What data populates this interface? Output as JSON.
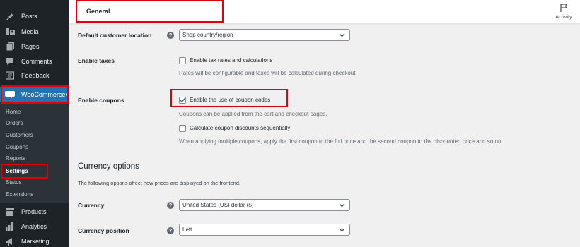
{
  "sidebar": {
    "top_items": [
      {
        "label": "Posts",
        "icon": "pin-icon"
      },
      {
        "label": "Media",
        "icon": "media-icon"
      },
      {
        "label": "Pages",
        "icon": "pages-icon"
      },
      {
        "label": "Comments",
        "icon": "comments-icon"
      },
      {
        "label": "Feedback",
        "icon": "feedback-icon"
      }
    ],
    "woocommerce": {
      "label": "WooCommerce",
      "icon": "woocommerce-icon"
    },
    "submenu": [
      "Home",
      "Orders",
      "Customers",
      "Coupons",
      "Reports",
      "Settings",
      "Status",
      "Extensions"
    ],
    "current_submenu": "Settings",
    "bottom_items": [
      {
        "label": "Products",
        "icon": "products-icon"
      },
      {
        "label": "Analytics",
        "icon": "analytics-icon"
      },
      {
        "label": "Marketing",
        "icon": "marketing-icon"
      }
    ]
  },
  "header": {
    "title": "General",
    "activity_label": "Activity"
  },
  "settings": {
    "default_location": {
      "label": "Default customer location",
      "value": "Shop country/region"
    },
    "enable_taxes": {
      "label": "Enable taxes",
      "checkbox_label": "Enable tax rates and calculations",
      "checked": false,
      "description": "Rates will be configurable and taxes will be calculated during checkout."
    },
    "enable_coupons": {
      "label": "Enable coupons",
      "checkbox_label": "Enable the use of coupon codes",
      "checked": true,
      "description": "Coupons can be applied from the cart and checkout pages.",
      "sequential_label": "Calculate coupon discounts sequentially",
      "sequential_checked": false,
      "sequential_description": "When applying multiple coupons, apply the first coupon to the full price and the second coupon to the discounted price and so on."
    }
  },
  "currency_options": {
    "heading": "Currency options",
    "description": "The following options affect how prices are displayed on the frontend.",
    "currency": {
      "label": "Currency",
      "value": "United States (US) dollar ($)"
    },
    "position": {
      "label": "Currency position",
      "value": "Left"
    }
  },
  "colors": {
    "sidebar_bg": "#1d2327",
    "submenu_bg": "#2c3338",
    "accent": "#2271b1",
    "highlight": "#e0000b",
    "content_bg": "#f0f0f1"
  }
}
